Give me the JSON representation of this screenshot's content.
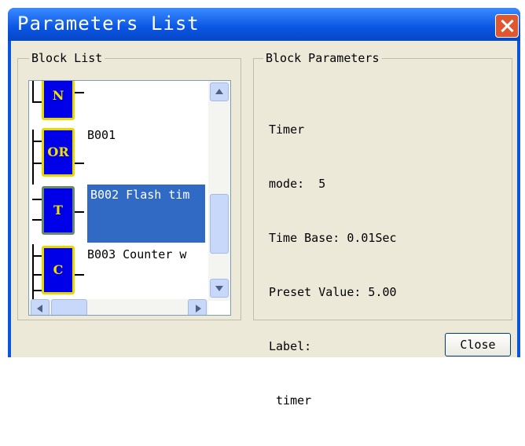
{
  "window": {
    "title": "Parameters List"
  },
  "block_list": {
    "legend": "Block List",
    "blocks": [
      {
        "symbol": "N"
      },
      {
        "symbol": "OR",
        "label": "B001"
      },
      {
        "symbol": "T",
        "label": "B002 Flash tim",
        "selected": true
      },
      {
        "symbol": "C",
        "label": "B003 Counter w"
      }
    ]
  },
  "block_parameters": {
    "legend": "Block Parameters",
    "lines": [
      "Timer",
      "mode:  5",
      "Time Base: 0.01Sec",
      "Preset Value: 5.00",
      "Label:",
      " timer"
    ]
  },
  "buttons": {
    "close": "Close"
  },
  "colors": {
    "title_bar": "#0a55e2",
    "selection": "#316ac5",
    "block_fill": "#0000e8",
    "block_text": "#f0e000",
    "dialog_bg": "#ece9d8"
  }
}
